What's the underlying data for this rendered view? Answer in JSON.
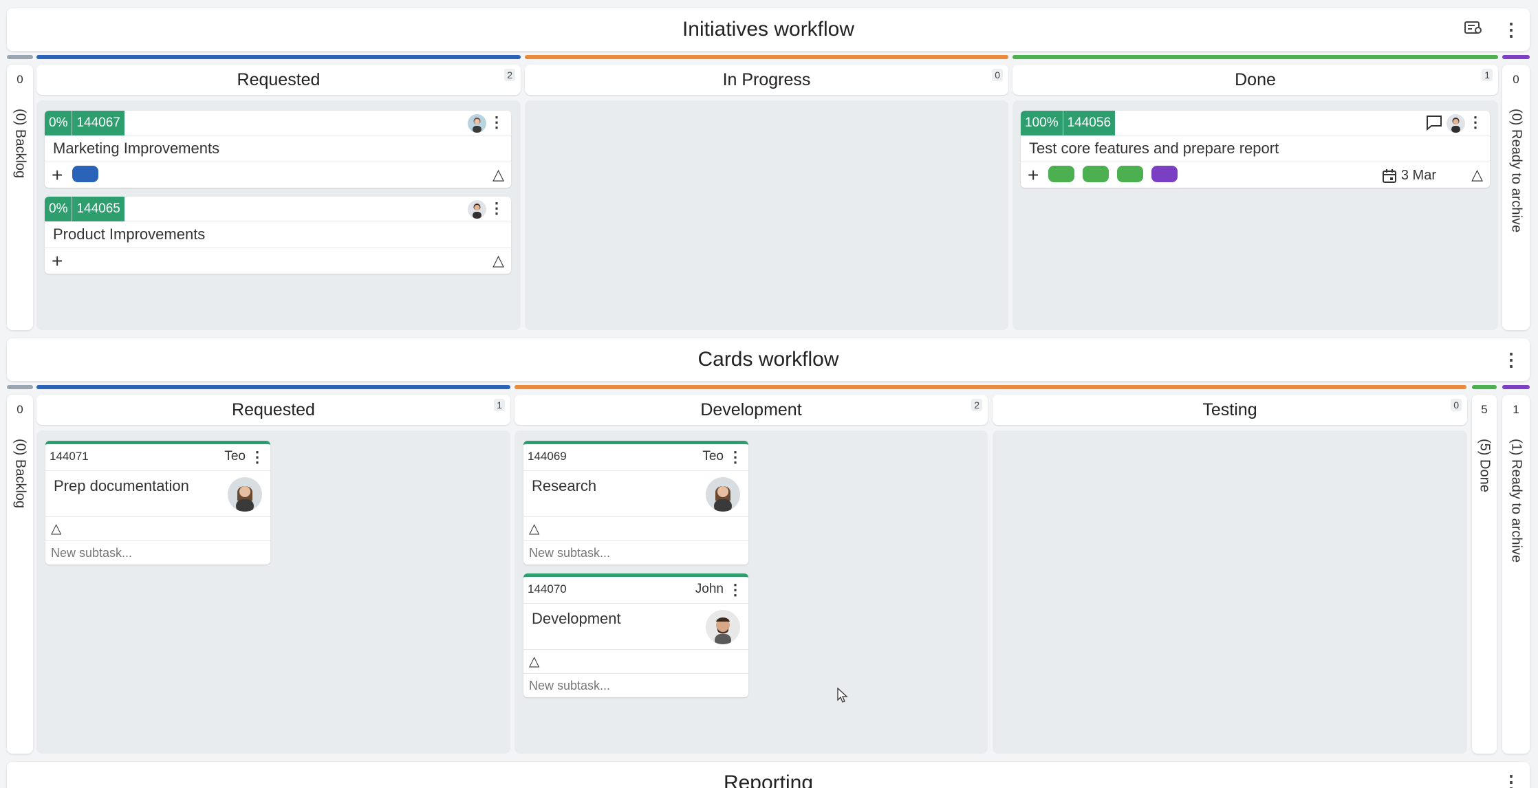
{
  "initiatives": {
    "title": "Initiatives workflow",
    "left_side": {
      "count": "0",
      "label": "(0) Backlog"
    },
    "right_side": {
      "count": "0",
      "label": "(0) Ready to archive"
    },
    "columns": [
      {
        "name": "Requested",
        "count": "2",
        "color": "#2a63b8"
      },
      {
        "name": "In Progress",
        "count": "0",
        "color": "#ea8a3a"
      },
      {
        "name": "Done",
        "count": "1",
        "color": "#4caf50"
      }
    ],
    "cards": [
      {
        "pct": "0%",
        "id": "144067",
        "title": "Marketing Improvements",
        "tags": [
          "#2a63b8"
        ]
      },
      {
        "pct": "0%",
        "id": "144065",
        "title": "Product Improvements",
        "tags": []
      },
      {
        "pct": "100%",
        "id": "144056",
        "title": "Test core features and prepare report",
        "tags": [
          "#4caf50",
          "#4caf50",
          "#4caf50",
          "#7b3fc4"
        ],
        "date": "3 Mar"
      }
    ]
  },
  "cards_wf": {
    "title": "Cards workflow",
    "left_side": {
      "count": "0",
      "label": "(0) Backlog"
    },
    "done_side": {
      "count": "5",
      "label": "(5) Done"
    },
    "right_side": {
      "count": "1",
      "label": "(1) Ready to archive"
    },
    "columns": [
      {
        "name": "Requested",
        "count": "1",
        "color": "#2a63b8"
      },
      {
        "name": "Development",
        "count": "2",
        "color": "#ea8a3a"
      },
      {
        "name": "Testing",
        "count": "0",
        "color": "#ea8a3a"
      }
    ],
    "cards": [
      {
        "id": "144071",
        "owner": "Teo",
        "title": "Prep documentation",
        "subtask": "New subtask..."
      },
      {
        "id": "144069",
        "owner": "Teo",
        "title": "Research",
        "subtask": "New subtask..."
      },
      {
        "id": "144070",
        "owner": "John",
        "title": "Development",
        "subtask": "New subtask..."
      }
    ]
  },
  "reporting": {
    "title": "Reporting"
  },
  "colors": {
    "accent_green": "#2e9e6e",
    "blue": "#2a63b8",
    "orange": "#ea8a3a",
    "green": "#4caf50",
    "purple": "#7b3fc4",
    "grey": "#9aa5b1"
  }
}
